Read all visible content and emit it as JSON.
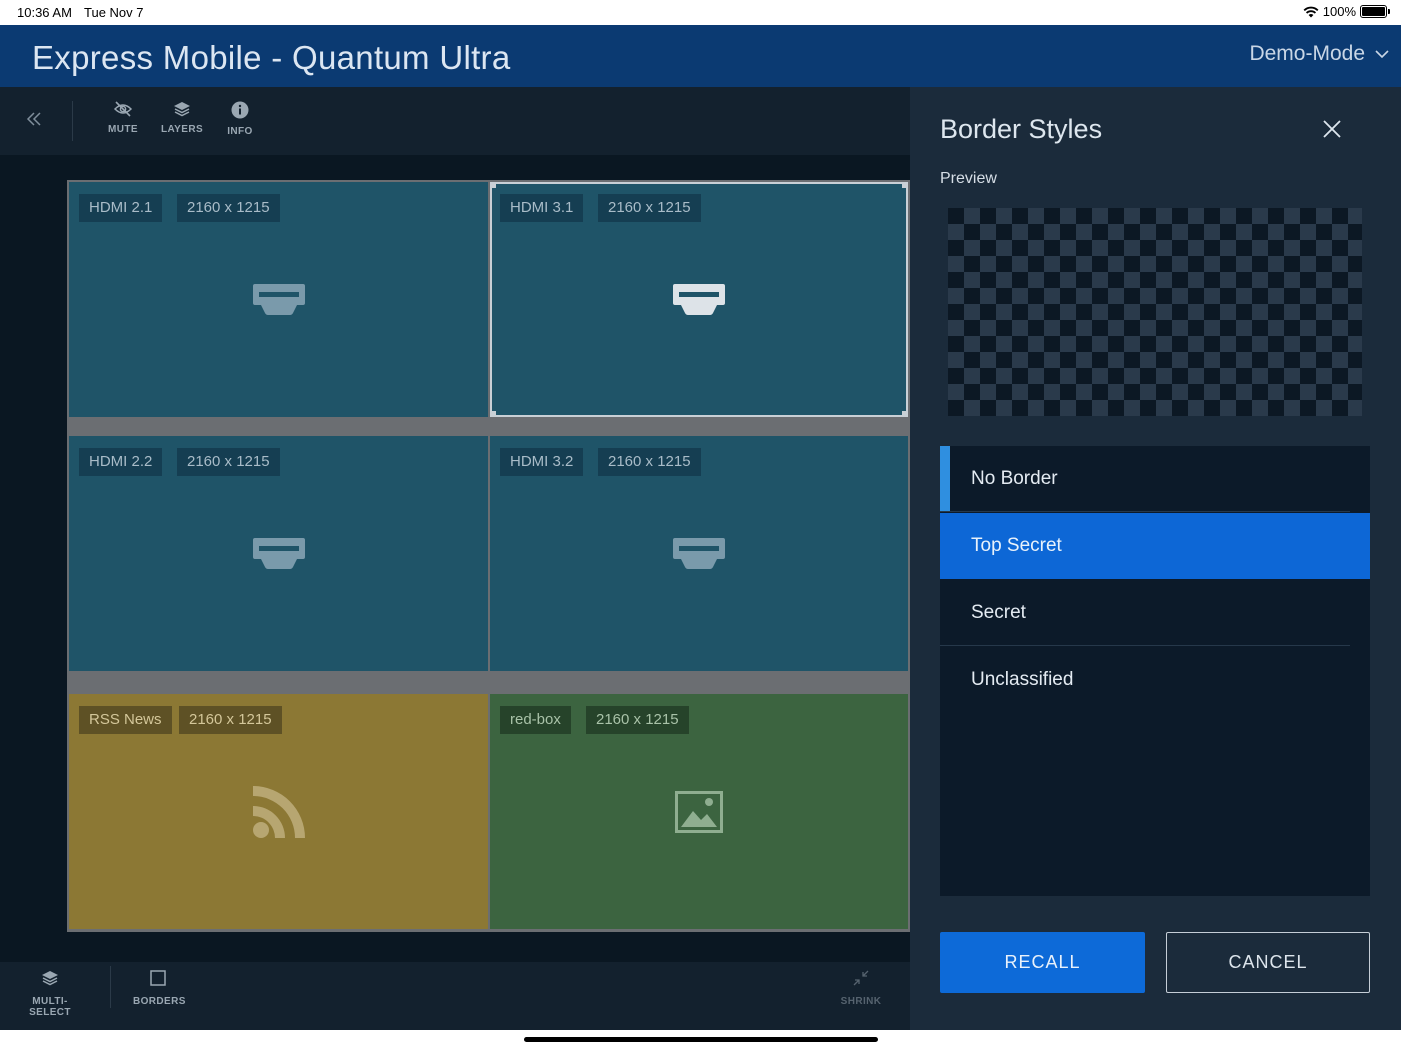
{
  "status": {
    "time": "10:36 AM",
    "date": "Tue Nov 7",
    "battery": "100%"
  },
  "app": {
    "title": "Express Mobile - Quantum Ultra",
    "mode": "Demo-Mode"
  },
  "toolbar": {
    "mute": "MUTE",
    "layers": "LAYERS",
    "info": "INFO"
  },
  "tiles": [
    {
      "source": "HDMI 2.1",
      "resolution": "2160 x 1215",
      "icon": "hdmi-icon"
    },
    {
      "source": "HDMI 3.1",
      "resolution": "2160 x 1215",
      "icon": "hdmi-icon",
      "selected": true
    },
    {
      "source": "HDMI 2.2",
      "resolution": "2160 x 1215",
      "icon": "hdmi-icon"
    },
    {
      "source": "HDMI 3.2",
      "resolution": "2160 x 1215",
      "icon": "hdmi-icon"
    },
    {
      "source": "RSS News",
      "resolution": "2160 x 1215",
      "icon": "rss-icon",
      "color": "#8c7834"
    },
    {
      "source": "red-box",
      "resolution": "2160 x 1215",
      "icon": "image-icon",
      "color": "#3c6440"
    }
  ],
  "bottombar": {
    "multi_select": "MULTI-SELECT",
    "borders": "BORDERS",
    "shrink": "SHRINK"
  },
  "panel": {
    "title": "Border Styles",
    "preview_label": "Preview",
    "options": [
      {
        "label": "No Border",
        "state": "current"
      },
      {
        "label": "Top Secret",
        "state": "selected"
      },
      {
        "label": "Secret",
        "state": "normal"
      },
      {
        "label": "Unclassified",
        "state": "normal"
      }
    ],
    "recall_label": "RECALL",
    "cancel_label": "CANCEL"
  },
  "colors": {
    "appbar": "#0b3a72",
    "accent": "#0d67d6",
    "tile_default": "#1f5468"
  }
}
